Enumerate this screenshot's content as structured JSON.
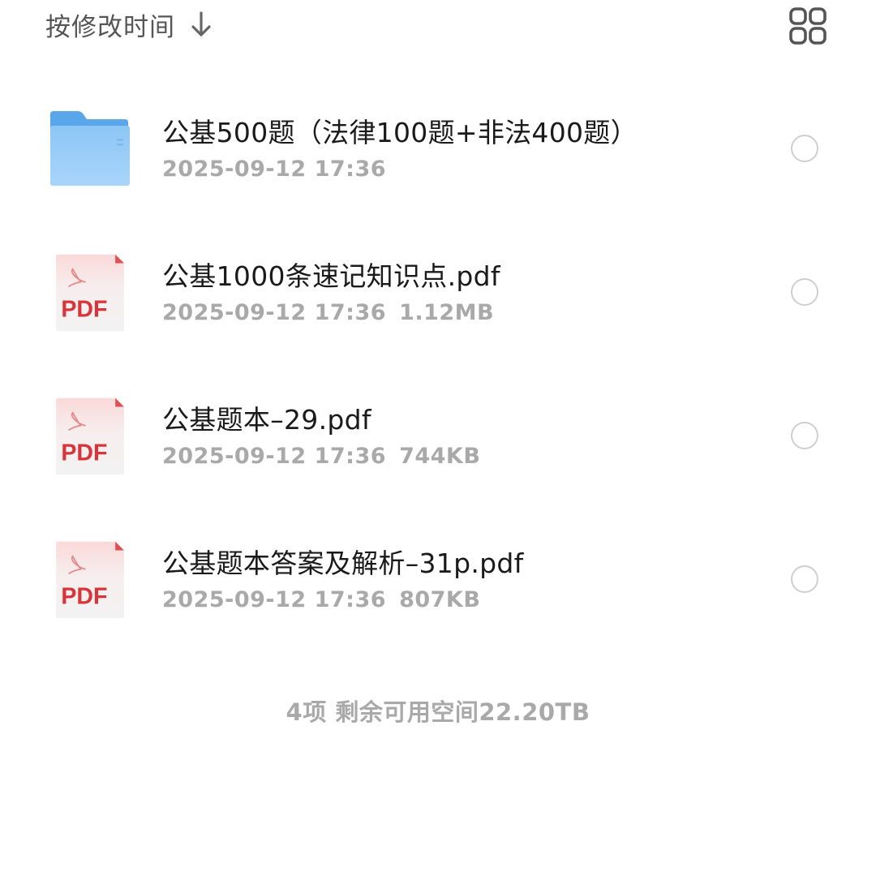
{
  "sort": {
    "label": "按修改时间",
    "arrow_icon": "arrow-down-icon",
    "direction": "descending"
  },
  "view_toggle": {
    "icon": "grid-view-icon"
  },
  "files": [
    {
      "type": "folder",
      "icon": "folder-icon",
      "name": "公基500题（法律100题+非法400题）",
      "modified": "2025-09-12 17:36",
      "size": "",
      "selected": false
    },
    {
      "type": "pdf",
      "icon": "pdf-file-icon",
      "icon_label": "PDF",
      "name": "公基1000条速记知识点.pdf",
      "modified": "2025-09-12 17:36",
      "size": "1.12MB",
      "selected": false
    },
    {
      "type": "pdf",
      "icon": "pdf-file-icon",
      "icon_label": "PDF",
      "name": "公基题本–29.pdf",
      "modified": "2025-09-12 17:36",
      "size": "744KB",
      "selected": false
    },
    {
      "type": "pdf",
      "icon": "pdf-file-icon",
      "icon_label": "PDF",
      "name": "公基题本答案及解析–31p.pdf",
      "modified": "2025-09-12 17:36",
      "size": "807KB",
      "selected": false
    }
  ],
  "footer": {
    "summary": "4项 剩余可用空间22.20TB"
  },
  "colors": {
    "folder_blue": "#6fb2ef",
    "pdf_red": "#d9343a",
    "meta_gray": "#a9a9a9",
    "radio_border": "#cfcfcf"
  }
}
